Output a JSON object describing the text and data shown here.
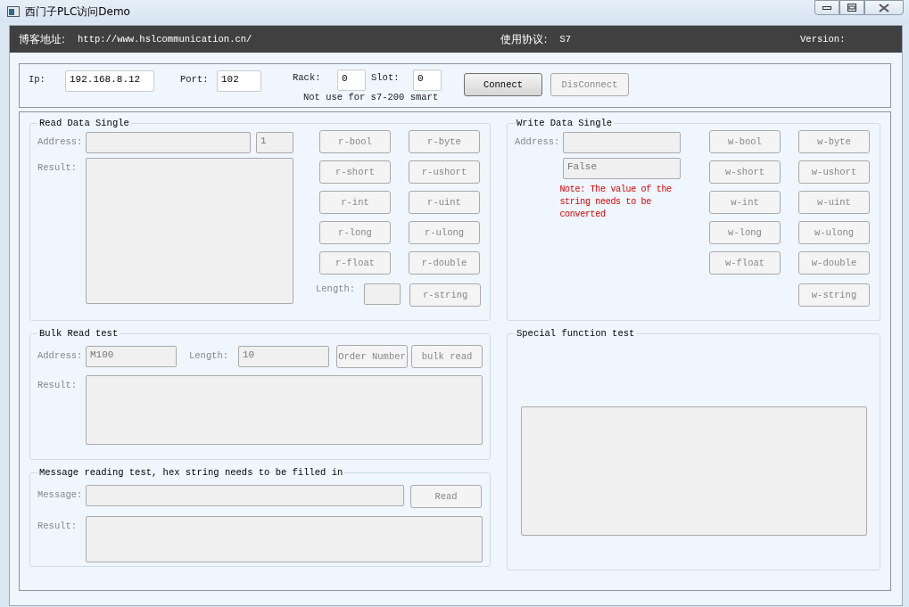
{
  "window": {
    "title": "西门子PLC访问Demo"
  },
  "header": {
    "blog_label": "博客地址:",
    "blog_url": "http://www.hslcommunication.cn/",
    "protocol_label": "使用协议:",
    "protocol_value": "S7",
    "version_label": "Version:"
  },
  "connection": {
    "ip": {
      "label": "Ip:",
      "value": "192.168.8.12",
      "disabled": false
    },
    "port": {
      "label": "Port:",
      "value": "102",
      "disabled": false
    },
    "rack": {
      "label": "Rack:",
      "value": "0",
      "disabled": false
    },
    "slot": {
      "label": "Slot:",
      "value": "0",
      "disabled": false
    },
    "note": "Not use for s7-200 smart",
    "buttons": [
      {
        "label": "Connect",
        "disabled": false
      },
      {
        "label": "DisConnect",
        "disabled": true
      }
    ]
  },
  "read_single": {
    "title": "Read Data Single",
    "address_label": "Address:",
    "address": {
      "disabled": true
    },
    "count": {
      "value": "1",
      "disabled": true
    },
    "result_label": "Result:",
    "result": {
      "disabled": true
    },
    "length_label": "Length:",
    "length": {
      "disabled": true
    },
    "buttons": [
      {
        "label": "r-bool",
        "disabled": true
      },
      {
        "label": "r-byte",
        "disabled": true
      },
      {
        "label": "r-short",
        "disabled": true
      },
      {
        "label": "r-ushort",
        "disabled": true
      },
      {
        "label": "r-int",
        "disabled": true
      },
      {
        "label": "r-uint",
        "disabled": true
      },
      {
        "label": "r-long",
        "disabled": true
      },
      {
        "label": "r-ulong",
        "disabled": true
      },
      {
        "label": "r-float",
        "disabled": true
      },
      {
        "label": "r-double",
        "disabled": true
      },
      {
        "label": "r-string",
        "disabled": true
      }
    ]
  },
  "write_single": {
    "title": "Write Data Single",
    "address_label": "Address:",
    "address": {
      "disabled": true
    },
    "value": {
      "value": "False",
      "disabled": true
    },
    "note": "Note: The value of the string needs to be converted",
    "buttons": [
      {
        "label": "w-bool",
        "disabled": true
      },
      {
        "label": "w-byte",
        "disabled": true
      },
      {
        "label": "w-short",
        "disabled": true
      },
      {
        "label": "w-ushort",
        "disabled": true
      },
      {
        "label": "w-int",
        "disabled": true
      },
      {
        "label": "w-uint",
        "disabled": true
      },
      {
        "label": "w-long",
        "disabled": true
      },
      {
        "label": "w-ulong",
        "disabled": true
      },
      {
        "label": "w-float",
        "disabled": true
      },
      {
        "label": "w-double",
        "disabled": true
      },
      {
        "label": "w-string",
        "disabled": true
      }
    ]
  },
  "bulk_read": {
    "title": "Bulk Read test",
    "address_label": "Address:",
    "address": {
      "value": "M100",
      "disabled": true
    },
    "length_label": "Length:",
    "length": {
      "value": "10",
      "disabled": true
    },
    "result_label": "Result:",
    "result": {
      "disabled": true
    },
    "buttons": [
      {
        "label": "Order Number",
        "disabled": true
      },
      {
        "label": "bulk read",
        "disabled": true
      }
    ]
  },
  "message_read": {
    "title": "Message reading test, hex string needs to be filled in",
    "message_label": "Message:",
    "message": {
      "disabled": true
    },
    "read_button": {
      "label": "Read",
      "disabled": true
    },
    "result_label": "Result:",
    "result": {
      "disabled": true
    }
  },
  "special": {
    "title": "Special function test",
    "result": {
      "disabled": true
    }
  }
}
